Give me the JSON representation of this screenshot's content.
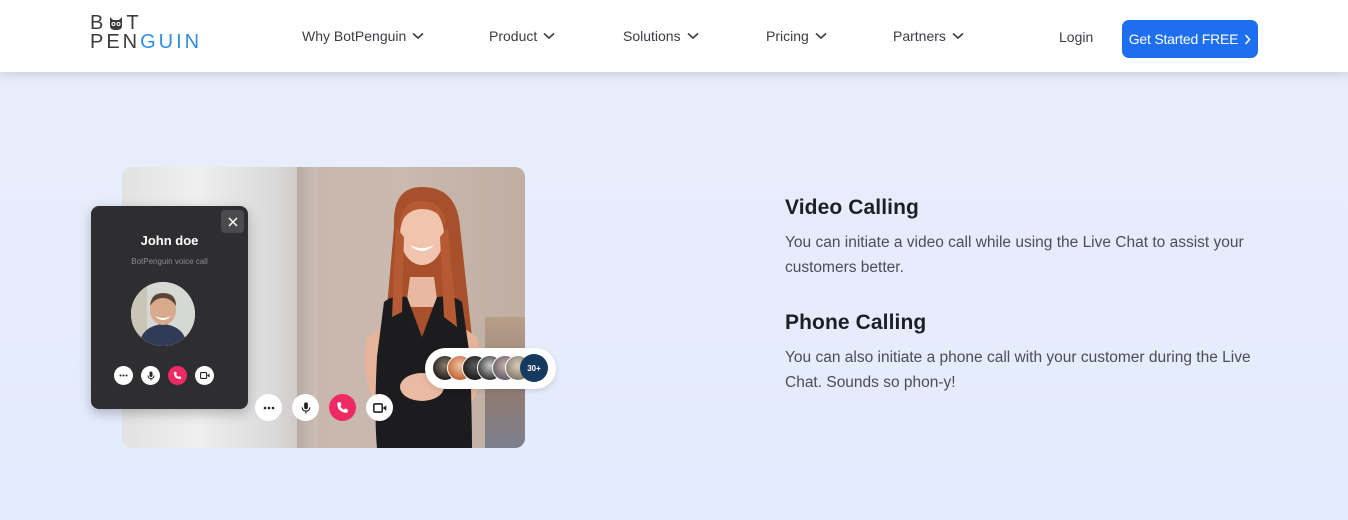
{
  "header": {
    "logo": {
      "line1_left": "B",
      "line1_right": "T",
      "line2_dark": "PEN",
      "line2_blue": "GUIN",
      "icon": "penguin-owl-icon"
    },
    "nav": [
      {
        "label": "Why BotPenguin",
        "icon": "chevron-down-icon"
      },
      {
        "label": "Product",
        "icon": "chevron-down-icon"
      },
      {
        "label": "Solutions",
        "icon": "chevron-down-icon"
      },
      {
        "label": "Pricing",
        "icon": "chevron-down-icon"
      },
      {
        "label": "Partners",
        "icon": "chevron-down-icon"
      }
    ],
    "login_label": "Login",
    "cta_label": "Get Started FREE",
    "cta_icon": "chevron-right-icon"
  },
  "media": {
    "call_card": {
      "name": "John doe",
      "subtitle": "BotPenguin voice call",
      "close_icon": "close-icon",
      "controls": [
        "more-icon",
        "microphone-icon",
        "phone-icon",
        "video-camera-icon"
      ]
    },
    "main_controls": [
      "more-icon",
      "microphone-icon",
      "phone-icon",
      "video-camera-icon"
    ],
    "participants": {
      "count_label": "30+",
      "faces": 6
    }
  },
  "features": [
    {
      "title": "Video Calling",
      "body": "You can initiate a video call while using the Live Chat to assist your customers better."
    },
    {
      "title": "Phone Calling",
      "body": "You can also initiate a phone call with your customer during the Live Chat. Sounds so phon-y!"
    }
  ],
  "colors": {
    "brand_blue": "#1e6ff0",
    "logo_blue": "#2f8ee0",
    "end_call_red": "#ee2a65",
    "page_background": "#e7edfc",
    "participants_badge": "#163a5f"
  }
}
